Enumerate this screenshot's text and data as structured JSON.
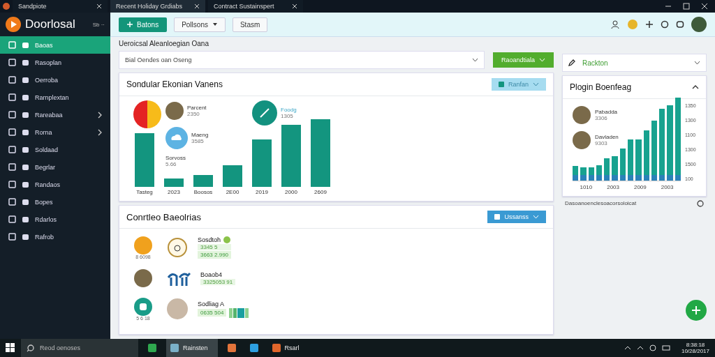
{
  "browser_tabs": [
    {
      "title": "Sandpiote",
      "selected": false
    },
    {
      "title": "Recent Holiday Grdiabs",
      "selected": true
    },
    {
      "title": "Contract Sustainspert",
      "selected": false
    }
  ],
  "sidebar": {
    "logo": "Doorlosal",
    "meta": "Sb ··",
    "items": [
      {
        "label": "Baoas",
        "selected": true,
        "expandable": false
      },
      {
        "label": "Rasoplan",
        "selected": false,
        "expandable": false
      },
      {
        "label": "Oerroba",
        "selected": false,
        "expandable": false
      },
      {
        "label": "Rarnplextan",
        "selected": false,
        "expandable": false
      },
      {
        "label": "Rareabaa",
        "selected": false,
        "expandable": true
      },
      {
        "label": "Rorna",
        "selected": false,
        "expandable": true
      },
      {
        "label": "Soldaad",
        "selected": false,
        "expandable": false
      },
      {
        "label": "Begrlar",
        "selected": false,
        "expandable": false
      },
      {
        "label": "Randaos",
        "selected": false,
        "expandable": false
      },
      {
        "label": "Bopes",
        "selected": false,
        "expandable": false
      },
      {
        "label": "Rdarlos",
        "selected": false,
        "expandable": false
      },
      {
        "label": "Rafrob",
        "selected": false,
        "expandable": false
      }
    ]
  },
  "toolbar": {
    "primary_button": "Batons",
    "dropdown": "Pollsons",
    "button": "Stasm"
  },
  "filter": {
    "label": "Ueroicsal Aleanloegian Oana",
    "search_value": "Bial Oendes oan Oseng",
    "action": "Raoandtiala",
    "select": "Rackton"
  },
  "overview_card": {
    "title": "Sondular Ekonian Vanens",
    "button": "Ranfan",
    "categories": [
      "Tasteg",
      "2023",
      "Boosos",
      "2E00",
      "2019",
      "2000",
      "2609"
    ],
    "callouts": [
      {
        "name": "Parcent",
        "value": "2350"
      },
      {
        "name": "Maeng",
        "value": "3585"
      },
      {
        "name": "Sorvoss",
        "value": "5.66"
      },
      {
        "name": "Foodg",
        "value": "1305"
      }
    ]
  },
  "growth_card": {
    "title": "Plogin Boenfeag",
    "expanded": true,
    "people": [
      {
        "name": "Pabadda",
        "value": "3306"
      },
      {
        "name": "Davladen",
        "value": "9303"
      }
    ],
    "y_labels": [
      "1350",
      "1300",
      "1100",
      "1300",
      "1500",
      "100"
    ],
    "x_labels": [
      "1010",
      "2003",
      "2009",
      "2003"
    ],
    "footer": "Dasoanoenclesoacorsoloicat"
  },
  "contacts_card": {
    "title": "Conrtleo Baeolrias",
    "button": "Ussanss",
    "rows": [
      {
        "kind": "badge",
        "tag": "8 6098",
        "name": "Sosdtoh",
        "verified": true,
        "detail": "3345 5",
        "value": "3663 2.990"
      },
      {
        "kind": "plain",
        "name": "Boaob4",
        "verified": false,
        "detail": "3325053 91"
      },
      {
        "kind": "bars",
        "tag": "5 6 18",
        "name": "Sodliag A",
        "verified": false,
        "detail": "",
        "value": "0635 504"
      }
    ]
  },
  "taskbar": {
    "search": "Reod oenoses",
    "apps": [
      {
        "selected": false
      },
      {
        "label": "Rainsten",
        "selected": true
      },
      {
        "selected": false
      },
      {
        "selected": false
      },
      {
        "label": "Rsarl",
        "selected": false
      }
    ],
    "time": "8:38:18",
    "date": "10/28/2017"
  }
}
